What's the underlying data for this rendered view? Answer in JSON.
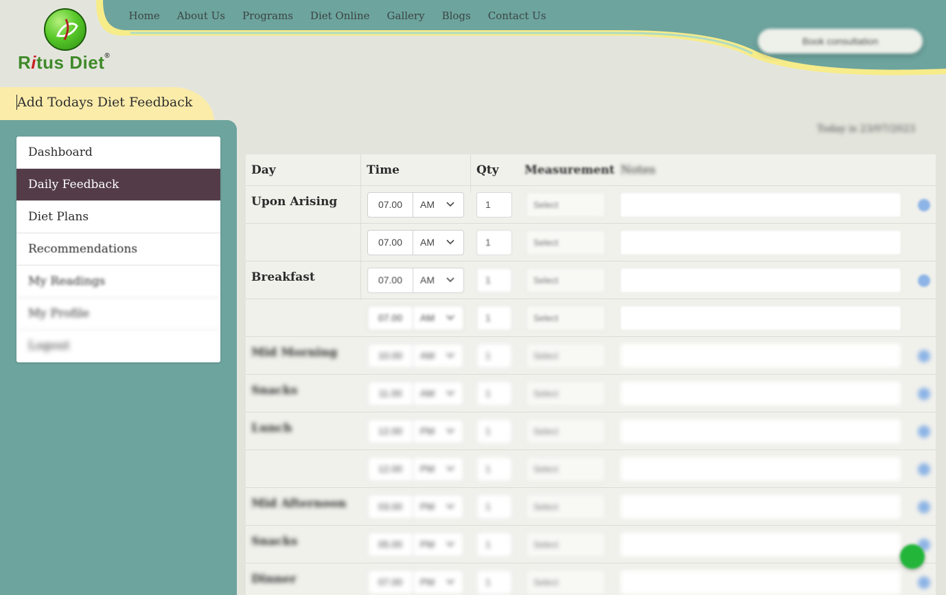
{
  "brand": {
    "logo_text_pre": "R",
    "logo_text_i": "i",
    "logo_text_post": "tus Diet",
    "registered": "®"
  },
  "nav": {
    "items": [
      "Home",
      "About Us",
      "Programs",
      "Diet Online",
      "Gallery",
      "Blogs",
      "Contact Us"
    ],
    "consult_label": "Book consultation"
  },
  "page": {
    "title": "Add Todays Diet Feedback",
    "today": "Today is 23/07/2023"
  },
  "sidebar": {
    "items": [
      {
        "label": "Dashboard",
        "active": false
      },
      {
        "label": "Daily Feedback",
        "active": true
      },
      {
        "label": "Diet Plans",
        "active": false
      },
      {
        "label": "Recommendations",
        "active": false
      },
      {
        "label": "My Readings",
        "active": false
      },
      {
        "label": "My Profile",
        "active": false
      },
      {
        "label": "Logout",
        "active": false
      }
    ]
  },
  "table": {
    "headers": {
      "day": "Day",
      "time": "Time",
      "qty": "Qty",
      "measurement": "Measurement",
      "notes": "Notes"
    },
    "rows": [
      {
        "day": "Upon Arising",
        "time": "07.00",
        "ampm": "AM",
        "qty": "1",
        "measurement": "Select"
      },
      {
        "day": "",
        "time": "07.00",
        "ampm": "AM",
        "qty": "1",
        "measurement": "Select"
      },
      {
        "day": "Breakfast",
        "time": "07.00",
        "ampm": "AM",
        "qty": "1",
        "measurement": "Select"
      },
      {
        "day": "",
        "time": "07.00",
        "ampm": "AM",
        "qty": "1",
        "measurement": "Select"
      },
      {
        "day": "Mid Morning",
        "time": "10.00",
        "ampm": "AM",
        "qty": "1",
        "measurement": "Select"
      },
      {
        "day": "Snacks",
        "time": "11.00",
        "ampm": "AM",
        "qty": "1",
        "measurement": "Select"
      },
      {
        "day": "Lunch",
        "time": "12.00",
        "ampm": "PM",
        "qty": "1",
        "measurement": "Select"
      },
      {
        "day": "",
        "time": "12.00",
        "ampm": "PM",
        "qty": "1",
        "measurement": "Select"
      },
      {
        "day": "Mid Afternoon",
        "time": "03.00",
        "ampm": "PM",
        "qty": "1",
        "measurement": "Select"
      },
      {
        "day": "Snacks",
        "time": "05.00",
        "ampm": "PM",
        "qty": "1",
        "measurement": "Select"
      },
      {
        "day": "Dinner",
        "time": "07.00",
        "ampm": "PM",
        "qty": "1",
        "measurement": "Select"
      }
    ]
  },
  "colors": {
    "teal": "#6da49e",
    "active_nav": "#533c48",
    "title_tab": "#fbecaa",
    "page_bg": "#e3e5dd",
    "chat": "#22b53a"
  }
}
